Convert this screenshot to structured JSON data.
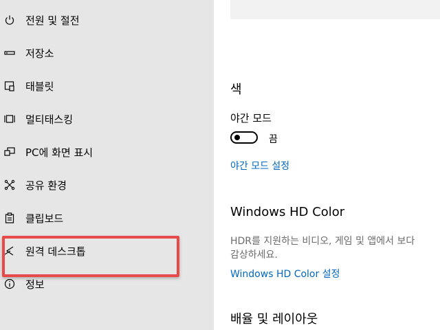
{
  "sidebar": {
    "items": [
      {
        "label": "전원 및 절전",
        "icon": "power-icon"
      },
      {
        "label": "저장소",
        "icon": "storage-icon"
      },
      {
        "label": "태블릿",
        "icon": "tablet-icon"
      },
      {
        "label": "멀티태스킹",
        "icon": "multitasking-icon"
      },
      {
        "label": "PC에 화면 표시",
        "icon": "project-icon"
      },
      {
        "label": "공유 환경",
        "icon": "shared-experiences-icon"
      },
      {
        "label": "클립보드",
        "icon": "clipboard-icon"
      },
      {
        "label": "원격 데스크톱",
        "icon": "remote-desktop-icon"
      },
      {
        "label": "정보",
        "icon": "info-icon"
      }
    ],
    "highlight_color": "#e84a4a"
  },
  "main": {
    "color_section_title": "색",
    "night_mode_label": "야간 모드",
    "night_mode_state": "끔",
    "night_mode_on": false,
    "night_mode_settings_link": "야간 모드 설정",
    "hd_color_title": "Windows HD Color",
    "hd_color_desc_line1": "HDR를 지원하는 비디오, 게임 및 앱에서 보다",
    "hd_color_desc_line2": "감상하세요.",
    "hd_color_settings_link": "Windows HD Color 설정",
    "layout_section_title": "배율 및 레이아웃",
    "link_color": "#0067c0"
  }
}
